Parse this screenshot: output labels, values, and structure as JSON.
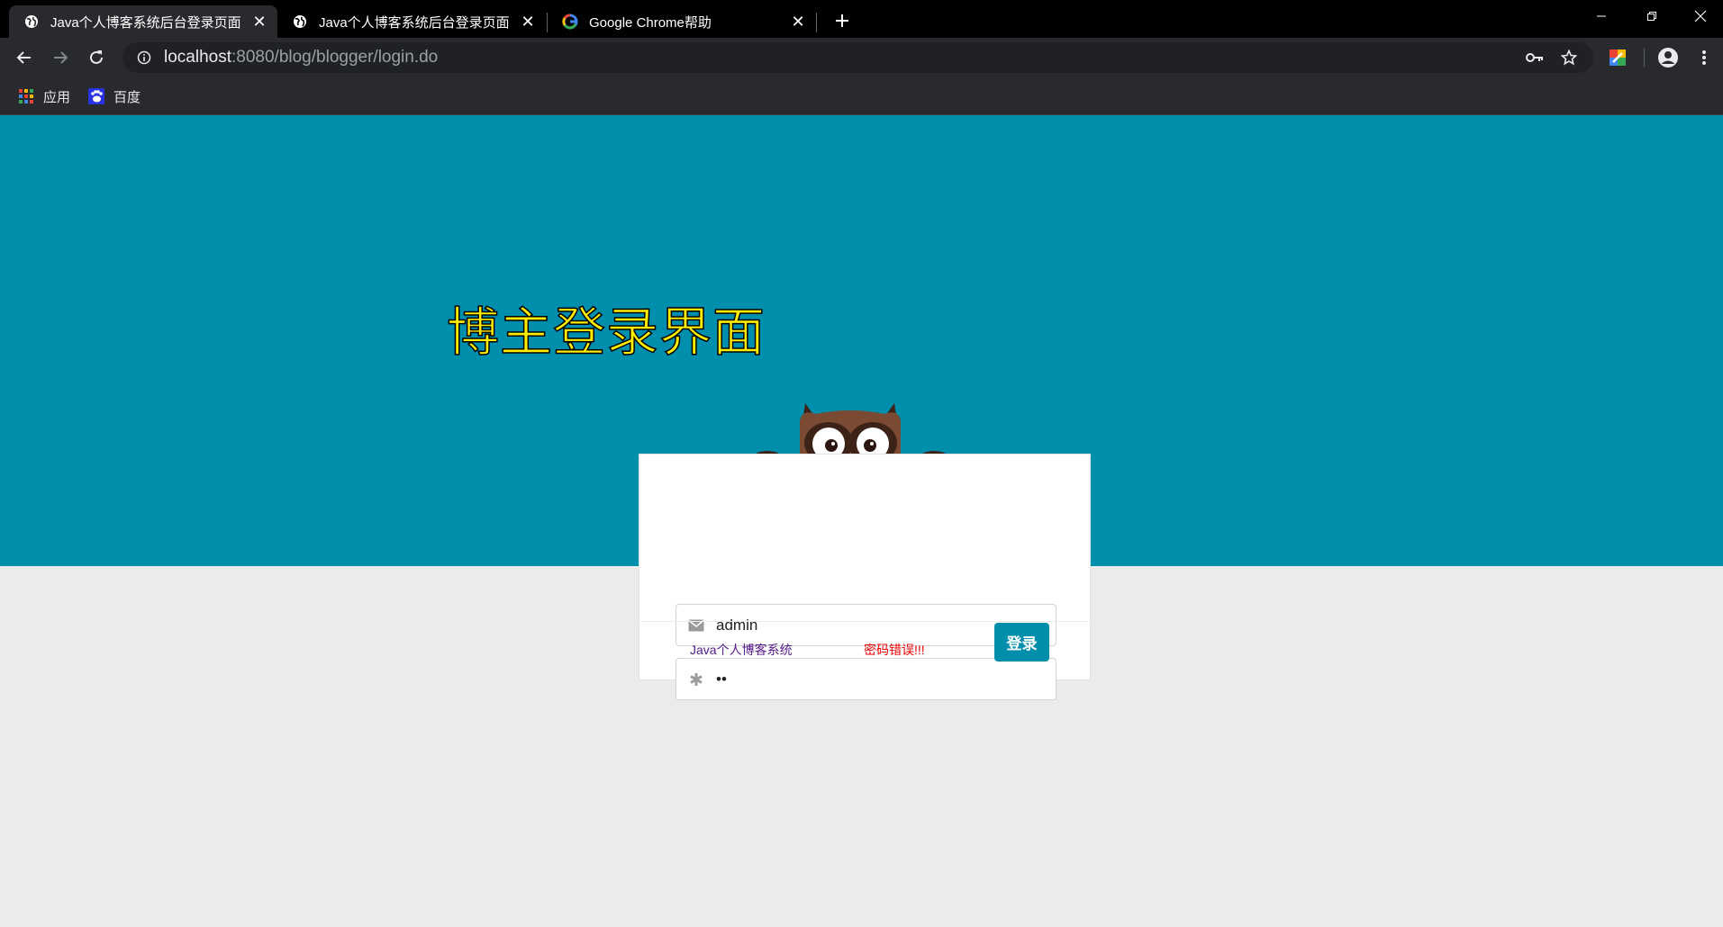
{
  "browser": {
    "tabs": [
      {
        "title": "Java个人博客系统后台登录页面",
        "icon": "globe-icon",
        "active": true
      },
      {
        "title": "Java个人博客系统后台登录页面",
        "icon": "globe-icon",
        "active": false
      },
      {
        "title": "Google Chrome帮助",
        "icon": "google-icon",
        "active": false
      }
    ],
    "new_tab_icon": "plus-icon",
    "window_controls": [
      "minimize-icon",
      "restore-icon",
      "close-icon"
    ],
    "address_bar": {
      "host": "localhost",
      "path": ":8080/blog/blogger/login.do"
    },
    "bookmarks": [
      {
        "label": "应用",
        "icon": "apps-grid-icon"
      },
      {
        "label": "百度",
        "icon": "baidu-icon"
      }
    ]
  },
  "page": {
    "heading": "博主登录界面",
    "username_value": "admin",
    "password_value": "••",
    "brand_link": "Java个人博客系统",
    "error_message": "密码错误!!!",
    "login_button": "登录"
  },
  "colors": {
    "hero": "#008ead",
    "heading_text": "#ffee00",
    "error": "#ee0000",
    "button": "#008ead"
  }
}
